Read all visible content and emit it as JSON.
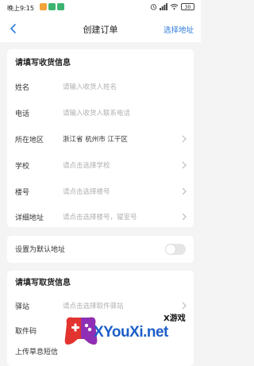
{
  "status_bar": {
    "time": "晚上9:15",
    "battery": "30",
    "app_icon_colors": [
      "#f2a33a",
      "#3cb371",
      "#3cb371"
    ],
    "icons": [
      "alarm-icon",
      "signal-icon",
      "wifi-icon",
      "battery-icon"
    ]
  },
  "nav": {
    "title": "创建订单",
    "right_action": "选择地址",
    "back_icon": "chevron-left-icon"
  },
  "accent_color": "#2f7bd9",
  "receive": {
    "title": "请填写收货信息",
    "name": {
      "label": "姓名",
      "placeholder": "请输入收货人姓名"
    },
    "phone": {
      "label": "电话",
      "placeholder": "请输入收货人联系电话"
    },
    "region": {
      "label": "所在地区",
      "value": "浙江省 杭州市 江干区"
    },
    "school": {
      "label": "学校",
      "placeholder": "请点击选择学校"
    },
    "building": {
      "label": "楼号",
      "placeholder": "请点击选择楼号"
    },
    "address": {
      "label": "详细地址",
      "placeholder": "请点击选择楼号，寝室号"
    }
  },
  "default_address": {
    "label": "设置为默认地址",
    "enabled": false
  },
  "pickup": {
    "title": "请填写取货信息",
    "station": {
      "label": "驿站",
      "placeholder": "请点击选择取件驿站"
    },
    "code": {
      "label": "取件码",
      "placeholder": ""
    },
    "upload": {
      "label": "上传草息短信"
    }
  },
  "watermark": {
    "tag": "X游戏",
    "site": "XYouXi.net",
    "logo_colors": [
      "#e2332f",
      "#8e2fb5",
      "#ffffff"
    ]
  }
}
